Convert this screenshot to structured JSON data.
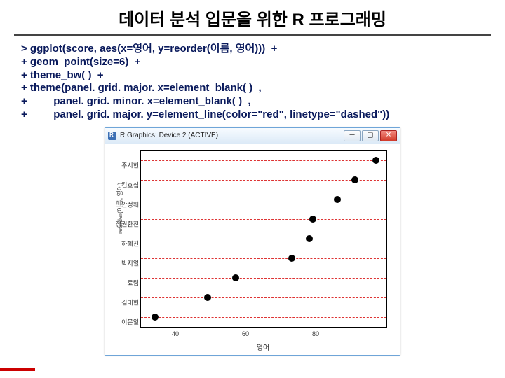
{
  "title": "데이터 분석 입문을 위한 R 프로그래밍",
  "code": {
    "l1": "> ggplot(score, aes(x=영어, y=reorder(이름, 영어)))  +",
    "l2": "+ geom_point(size=6)  +",
    "l3": "+ theme_bw( )  +",
    "l4": "+ theme(panel. grid. major. x=element_blank( )  ,",
    "l5": "+         panel. grid. minor. x=element_blank( )  ,",
    "l6": "+         panel. grid. major. y=element_line(color=\"red\", linetype=\"dashed\"))"
  },
  "window": {
    "title": "R Graphics: Device 2 (ACTIVE)",
    "min": "─",
    "max": "▢",
    "close": "✕"
  },
  "chart_data": {
    "type": "scatter",
    "xlabel": "영어",
    "ylabel": "reorder(이름, 영어)",
    "xlim": [
      30,
      100
    ],
    "xticks": [
      40,
      60,
      80
    ],
    "y_categories": [
      "주시현",
      "김효섭",
      "안정훼",
      "정권환진",
      "하혜진",
      "박지열",
      "료림",
      "김대힌",
      "이문일"
    ],
    "points": [
      {
        "name": "주시현",
        "x": 97
      },
      {
        "name": "김효섭",
        "x": 91
      },
      {
        "name": "안정훼",
        "x": 86
      },
      {
        "name": "정권환진",
        "x": 79
      },
      {
        "name": "하혜진",
        "x": 78
      },
      {
        "name": "박지열",
        "x": 73
      },
      {
        "name": "료림",
        "x": 57
      },
      {
        "name": "김대힌",
        "x": 49
      },
      {
        "name": "이문일",
        "x": 34
      }
    ]
  }
}
